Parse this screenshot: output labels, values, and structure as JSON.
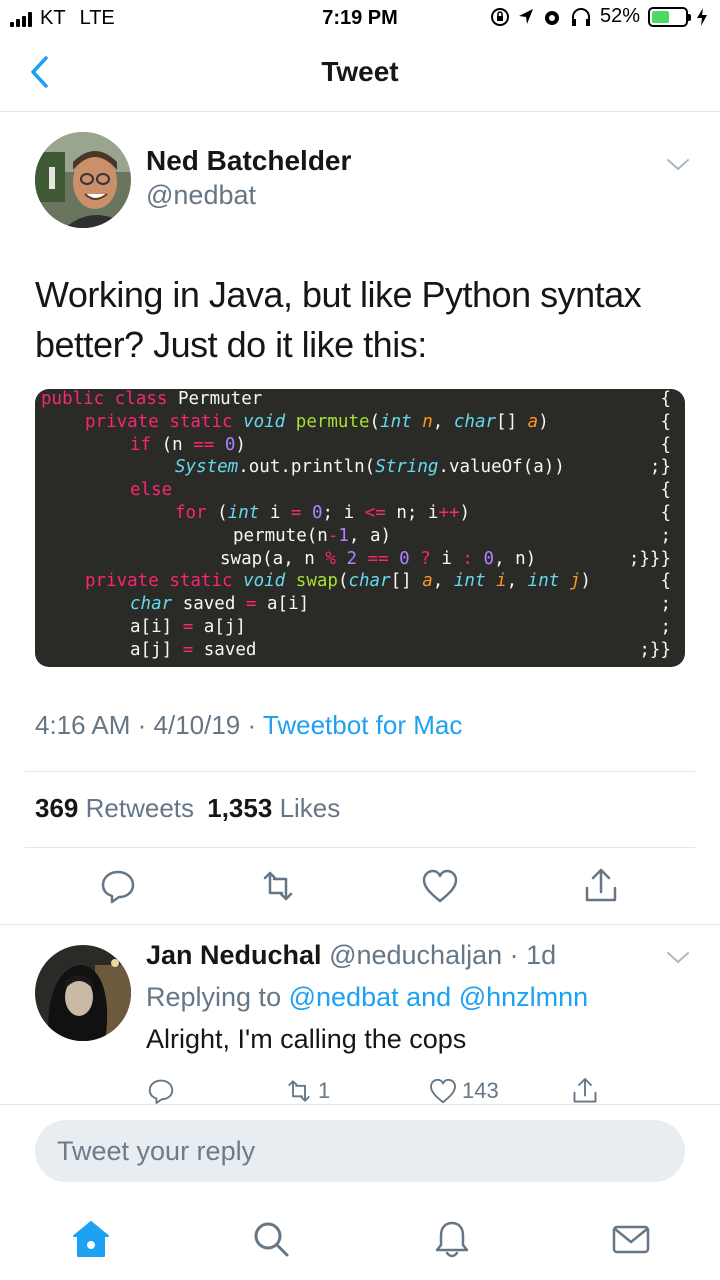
{
  "status_bar": {
    "carrier": "KT",
    "network": "LTE",
    "time": "7:19 PM",
    "battery": "52%",
    "battery_level": 0.52
  },
  "header": {
    "title": "Tweet"
  },
  "tweet": {
    "author_name": "Ned Batchelder",
    "author_handle": "@nedbat",
    "text": "Working in Java, but like Python syntax better? Just do it like this:",
    "time": "4:16 AM",
    "sep1": " · ",
    "date": "4/10/19",
    "sep2": " · ",
    "source": "Tweetbot for Mac",
    "retweets_count": "369",
    "retweets_label": "Retweets",
    "likes_count": "1,353",
    "likes_label": "Likes"
  },
  "code_image": {
    "brackets": [
      "{",
      "{",
      "{",
      ";}",
      "{",
      "{",
      ";",
      ";}}}",
      "{",
      ";",
      ";",
      ";}}"
    ]
  },
  "reply": {
    "author_name": "Jan Neduchal",
    "author_handle": "@neduchaljan",
    "dot": " · ",
    "age": "1d",
    "replying_prefix": "Replying to",
    "replying_link1": "@nedbat",
    "replying_and": "and",
    "replying_link2": "@hnzlmnn",
    "text": "Alright, I'm calling the cops",
    "retweet_count": "1",
    "like_count": "143"
  },
  "composer": {
    "placeholder": "Tweet your reply"
  },
  "tabbar": {
    "icons": [
      "home-icon",
      "search-icon",
      "notifications-icon",
      "messages-icon"
    ]
  },
  "colors": {
    "accent": "#1da1f2",
    "muted": "#657786",
    "code_bg": "#2a2a27"
  }
}
